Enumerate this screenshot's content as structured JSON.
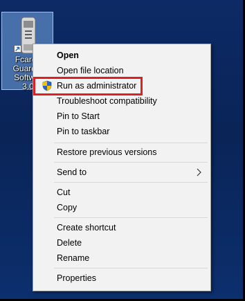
{
  "desktop": {
    "icon": {
      "label": "Fcard2\nGuard T\nSoftwar\n3.0",
      "image_icon": "usb-device-icon",
      "shortcut_icon": "shortcut-arrow-icon"
    }
  },
  "context_menu": {
    "items": [
      {
        "label": "Open",
        "bold": true
      },
      {
        "label": "Open file location"
      },
      {
        "label": "Run as administrator",
        "icon": "uac-shield-icon"
      },
      {
        "label": "Troubleshoot compatibility"
      },
      {
        "label": "Pin to Start"
      },
      {
        "label": "Pin to taskbar"
      },
      {
        "label": "Restore previous versions"
      },
      {
        "label": "Send to",
        "submenu_icon": "chevron-right-icon"
      },
      {
        "label": "Cut"
      },
      {
        "label": "Copy"
      },
      {
        "label": "Create shortcut"
      },
      {
        "label": "Delete"
      },
      {
        "label": "Rename"
      },
      {
        "label": "Properties"
      }
    ]
  },
  "colors": {
    "highlight_box": "#e02020",
    "menu_background": "#f2f2f2",
    "desktop_background": "#0a2457"
  }
}
